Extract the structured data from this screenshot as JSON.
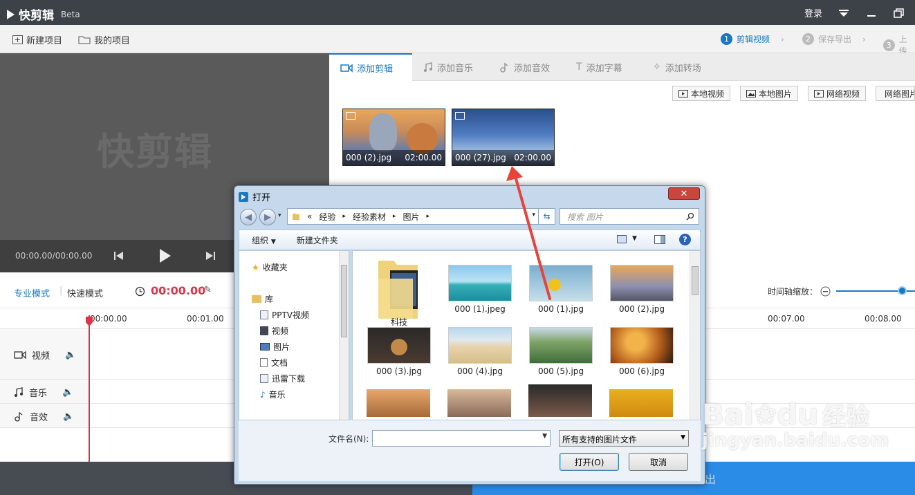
{
  "app": {
    "name": "快剪辑",
    "badge": "Beta",
    "login": "登录",
    "watermark": "快剪辑"
  },
  "toolbar": {
    "new_project": "新建项目",
    "my_projects": "我的项目"
  },
  "steps": [
    {
      "num": "1",
      "label": "剪辑视频"
    },
    {
      "num": "2",
      "label": "保存导出"
    },
    {
      "num": "3",
      "label": "上传"
    }
  ],
  "player": {
    "time": "00:00.00/00:00.00"
  },
  "tabs": [
    {
      "label": "添加剪辑",
      "icon": "video-camera-icon"
    },
    {
      "label": "添加音乐",
      "icon": "music-note-icon"
    },
    {
      "label": "添加音效",
      "icon": "sound-effect-icon"
    },
    {
      "label": "添加字幕",
      "icon": "text-icon"
    },
    {
      "label": "添加转场",
      "icon": "transition-icon"
    }
  ],
  "sources": [
    "本地视频",
    "本地图片",
    "网络视频",
    "网络图片"
  ],
  "clips": [
    {
      "name": "000 (2).jpg",
      "duration": "02:00.00"
    },
    {
      "name": "000 (27).jpg",
      "duration": "02:00.00"
    }
  ],
  "modes": {
    "pro": "专业模式",
    "quick": "快速模式",
    "time": "00:00.00",
    "zoom_label": "时间轴缩放："
  },
  "ruler": [
    "00:00.00",
    "00:01.00",
    "00:07.00",
    "00:08.00"
  ],
  "tracks": [
    {
      "label": "视频"
    },
    {
      "label": "音乐"
    },
    {
      "label": "音效"
    }
  ],
  "footer": {
    "save": "保存导出"
  },
  "dialog": {
    "title": "打开",
    "path": [
      "«",
      "经验",
      "经验素材",
      "图片"
    ],
    "search_placeholder": "搜索 图片",
    "organize": "组织",
    "new_folder": "新建文件夹",
    "nav": [
      "收藏夹",
      "库",
      "PPTV视频",
      "视频",
      "图片",
      "文档",
      "迅雷下载",
      "音乐"
    ],
    "files": [
      "科技",
      "000 (1).jpeg",
      "000 (1).jpg",
      "000 (2).jpg",
      "000 (3).jpg",
      "000 (4).jpg",
      "000 (5).jpg",
      "000 (6).jpg"
    ],
    "filename_label": "文件名(N):",
    "filename_value": "",
    "filter": "所有支持的图片文件",
    "open": "打开(O)",
    "cancel": "取消"
  },
  "site_watermark": {
    "brand": "Bai",
    "brand2": "du",
    "cn": "经验",
    "url": "jingyan.baidu.com"
  },
  "colors": {
    "accent": "#1a78c2",
    "time_red": "#d9364a",
    "arrow": "#e8423a"
  }
}
